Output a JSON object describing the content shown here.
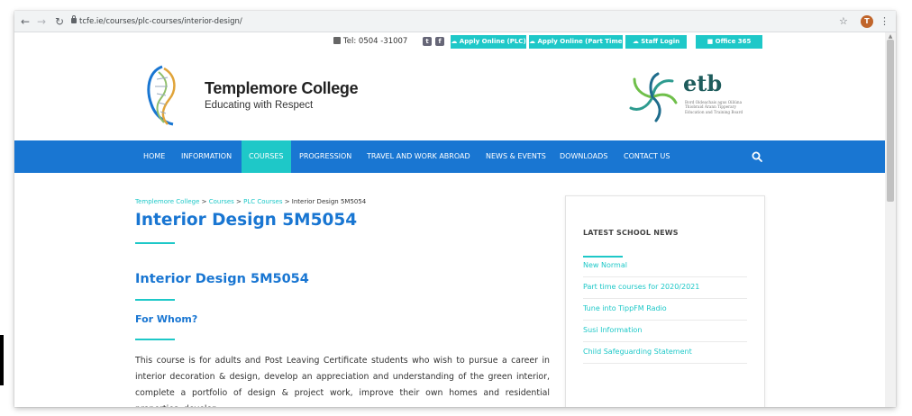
{
  "browser": {
    "url": "tcfe.ie/courses/plc-courses/interior-design/",
    "profile_initial": "T"
  },
  "utility_bar": {
    "tel": "Tel: 0504 -31007",
    "buttons": [
      "Apply Online (PLC)",
      "Apply Online (Part Time)",
      "Staff Login",
      "Office 365"
    ]
  },
  "header": {
    "college_name": "Templemore College",
    "tagline": "Educating with Respect",
    "etb_word": "etb",
    "etb_subtitle": "Bord Oideachais agus Oiliúna Thiobraid Árann Tipperary Education and Training Board"
  },
  "nav": {
    "items": [
      "HOME",
      "INFORMATION",
      "COURSES",
      "PROGRESSION",
      "TRAVEL AND WORK ABROAD",
      "NEWS & EVENTS",
      "DOWNLOADS",
      "CONTACT US"
    ],
    "active": "COURSES"
  },
  "content": {
    "breadcrumb": {
      "home": "Templemore College",
      "sep": " > ",
      "courses": "Courses",
      "plc": "PLC Courses",
      "current": "Interior Design 5M5054"
    },
    "page_title": "Interior Design 5M5054",
    "section_title": "Interior Design 5M5054",
    "subsection_title": "For Whom?",
    "body": "This course is for adults and Post Leaving Certificate students who wish to pursue a career in interior decoration & design, develop an appreciation and understanding of the green interior, complete a portfolio of design & project work, improve their own homes and residential properties, develop"
  },
  "sidebar": {
    "title": "LATEST SCHOOL NEWS",
    "news": [
      "New Normal",
      "Part time courses for 2020/2021",
      "Tune into TippFM Radio",
      "Susi Information",
      "Child Safeguarding Statement"
    ]
  },
  "colors": {
    "brand_blue": "#1976d2",
    "accent_teal": "#1ec8c8"
  },
  "icons": [
    "back-arrow-icon",
    "forward-arrow-icon",
    "reload-icon",
    "lock-icon",
    "star-icon",
    "more-menu-icon",
    "phone-icon",
    "twitter-icon",
    "facebook-icon",
    "cloud-icon",
    "office-icon",
    "search-icon",
    "helix-logo-icon",
    "etb-swirl-logo"
  ]
}
